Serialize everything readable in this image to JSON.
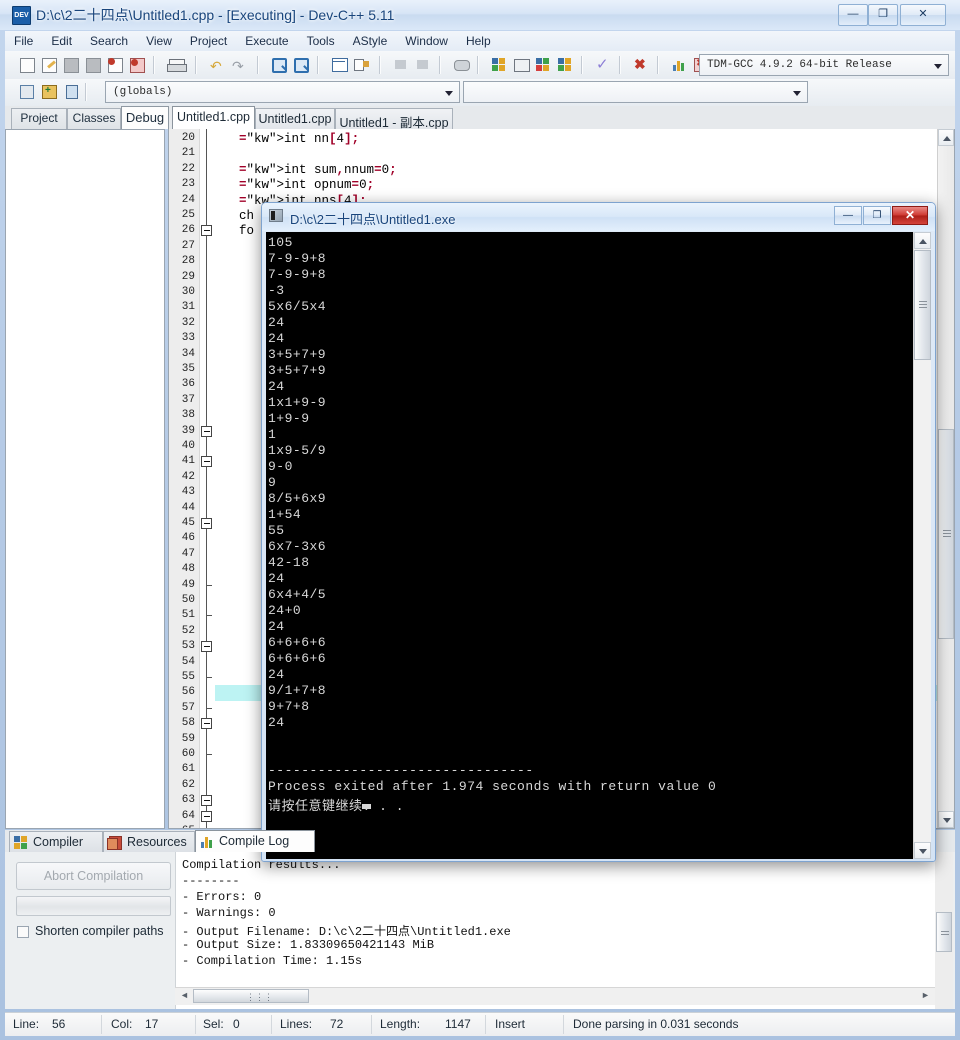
{
  "window": {
    "title": "D:\\c\\2二十四点\\Untitled1.cpp - [Executing] - Dev-C++ 5.11",
    "minimize": "—",
    "maximize": "❐",
    "close": "✕"
  },
  "menu": {
    "items": [
      "File",
      "Edit",
      "Search",
      "View",
      "Project",
      "Execute",
      "Tools",
      "AStyle",
      "Window",
      "Help"
    ]
  },
  "toolbar": {
    "compiler_value": "TDM-GCC 4.9.2 64-bit Release",
    "scope_value": "(globals)",
    "class_value": ""
  },
  "left_tabs": [
    {
      "label": "Project",
      "active": false
    },
    {
      "label": "Classes",
      "active": false
    },
    {
      "label": "Debug",
      "active": true
    }
  ],
  "editor_tabs": [
    {
      "label": "Untitled1.cpp",
      "active": true
    },
    {
      "label": "Untitled1.cpp",
      "active": false
    },
    {
      "label": "Untitled1 - 副本.cpp",
      "active": false
    }
  ],
  "editor": {
    "first_line": 20,
    "last_line": 65,
    "cursor_line": 56,
    "code": [
      {
        "line": 20,
        "text": "int nn[4];"
      },
      {
        "line": 22,
        "text": "int sum,nnum=0;"
      },
      {
        "line": 23,
        "text": "int opnum=0;"
      },
      {
        "line": 24,
        "text": "int nns[4];"
      },
      {
        "line": 25,
        "text": "ch"
      },
      {
        "line": 26,
        "text": "fo"
      }
    ],
    "fold_boxes": [
      26,
      39,
      41,
      45,
      53,
      58,
      63,
      64
    ],
    "fold_ticks": [
      49,
      51,
      55,
      57,
      60
    ]
  },
  "console": {
    "title": "D:\\c\\2二十四点\\Untitled1.exe",
    "minimize": "—",
    "maximize": "❐",
    "close": "✕",
    "output": [
      "105",
      "7-9-9+8",
      "7-9-9+8",
      "-3",
      "5x6/5x4",
      "24",
      "24",
      "3+5+7+9",
      "3+5+7+9",
      "24",
      "1x1+9-9",
      "1+9-9",
      "1",
      "1x9-5/9",
      "9-0",
      "9",
      "8/5+6x9",
      "1+54",
      "55",
      "6x7-3x6",
      "42-18",
      "24",
      "6x4+4/5",
      "24+0",
      "24",
      "6+6+6+6",
      "6+6+6+6",
      "24",
      "9/1+7+8",
      "9+7+8",
      "24",
      "",
      "",
      "--------------------------------",
      "Process exited after 1.974 seconds with return value 0",
      "请按任意键继续. . ."
    ]
  },
  "report": {
    "tabs": [
      {
        "label": "Compiler",
        "active": false
      },
      {
        "label": "Resources",
        "active": false
      },
      {
        "label": "Compile Log",
        "active": true
      }
    ],
    "abort_button": "Abort Compilation",
    "shorten_checkbox_label": "Shorten compiler paths",
    "log": [
      "Compilation results...",
      "--------",
      "- Errors: 0",
      "- Warnings: 0",
      "- Output Filename: D:\\c\\2二十四点\\Untitled1.exe",
      "- Output Size: 1.83309650421143 MiB",
      "- Compilation Time: 1.15s"
    ]
  },
  "statusbar": {
    "line_label": "Line:",
    "line_value": "56",
    "col_label": "Col:",
    "col_value": "17",
    "sel_label": "Sel:",
    "sel_value": "0",
    "lines_label": "Lines:",
    "lines_value": "72",
    "length_label": "Length:",
    "length_value": "1147",
    "insert_mode": "Insert",
    "message": "Done parsing in 0.031 seconds"
  },
  "colors": {
    "accent": "#19457c",
    "console_bg": "#000000",
    "console_fg": "#d8d8d8",
    "cursor_line": "#bdf3f3",
    "close_red": "#cf3a32"
  }
}
